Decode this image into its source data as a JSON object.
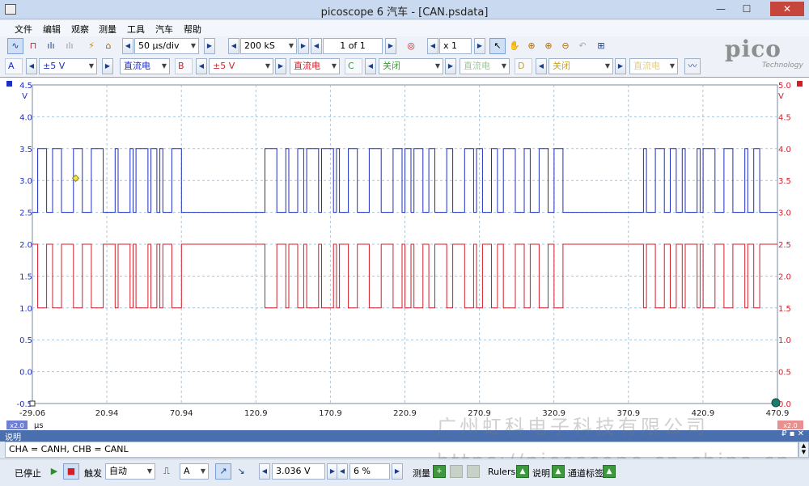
{
  "window": {
    "title": "picoscope 6 汽车 - [CAN.psdata]",
    "min": "—",
    "max": "☐",
    "close": "✕"
  },
  "menu": [
    "文件",
    "编辑",
    "观察",
    "测量",
    "工具",
    "汽车",
    "帮助"
  ],
  "toolbar1": {
    "timebase": "50 µs/div",
    "samples": "200 kS",
    "buffer": "1 of 1",
    "zoom": "x 1"
  },
  "channels": [
    {
      "letter": "A",
      "range": "±5 V",
      "coupling": "直流电",
      "color": "#1f2fbf"
    },
    {
      "letter": "B",
      "range": "±5 V",
      "coupling": "直流电",
      "color": "#d11f2a"
    },
    {
      "letter": "C",
      "range": "关闭",
      "coupling": "直流电",
      "color": "#3a9b3a"
    },
    {
      "letter": "D",
      "range": "关闭",
      "coupling": "直流电",
      "color": "#c9a227"
    }
  ],
  "logo": {
    "word": "pico",
    "tech": "Technology"
  },
  "scope": {
    "left_axis": {
      "unit": "V",
      "ticks": [
        "4.5",
        "4.0",
        "3.5",
        "3.0",
        "2.5",
        "2.0",
        "1.5",
        "1.0",
        "0.5",
        "0.0",
        "-0.5"
      ]
    },
    "right_axis": {
      "unit": "V",
      "ticks": [
        "5.0",
        "4.5",
        "4.0",
        "3.5",
        "3.0",
        "2.5",
        "2.0",
        "1.5",
        "1.0",
        "0.5",
        "0.0"
      ]
    },
    "x_ticks": [
      "-29.06",
      "20.94",
      "70.94",
      "120.9",
      "170.9",
      "220.9",
      "270.9",
      "320.9",
      "370.9",
      "420.9",
      "470.9"
    ],
    "x_unit": "µs",
    "zoom_left": "x2.0",
    "zoom_right": "x2.0"
  },
  "notes": {
    "title": "说明",
    "controls": "₽ ▪ ✕",
    "text": "CHA = CANH, CHB = CANL"
  },
  "bottom": {
    "stopped": "已停止",
    "trigger": "触发",
    "trigger_mode": "自动",
    "trigger_source": "A",
    "trigger_level": "3.036 V",
    "pre_trigger": "6 %",
    "measure": "测量",
    "rulers": "Rulers",
    "notes": "说明",
    "channel_labels": "通道标签"
  },
  "watermark": {
    "company": "广州虹科电子科技有限公司",
    "url": "https://picoscope.cn.china.cn"
  },
  "chart_data": {
    "type": "line",
    "xlabel": "µs",
    "xlim": [
      -29.06,
      470.9
    ],
    "ylim_left": [
      -0.5,
      4.5
    ],
    "ylim_right": [
      0.0,
      5.0
    ],
    "series": [
      {
        "name": "A",
        "axis": "left",
        "color": "#1f2fbf",
        "idle": 2.5,
        "dominant": 3.5,
        "frames": [
          {
            "start": -25,
            "end": 7.5
          },
          {
            "start": 25,
            "end": 55
          },
          {
            "start": 70,
            "end": 74
          }
        ]
      },
      {
        "name": "B",
        "axis": "right",
        "color": "#d11f2a",
        "idle": 2.5,
        "dominant": 1.5
      }
    ],
    "frame_segments_us": [
      [
        -25.5,
        71
      ],
      [
        127,
        329
      ],
      [
        381,
        465
      ]
    ]
  }
}
